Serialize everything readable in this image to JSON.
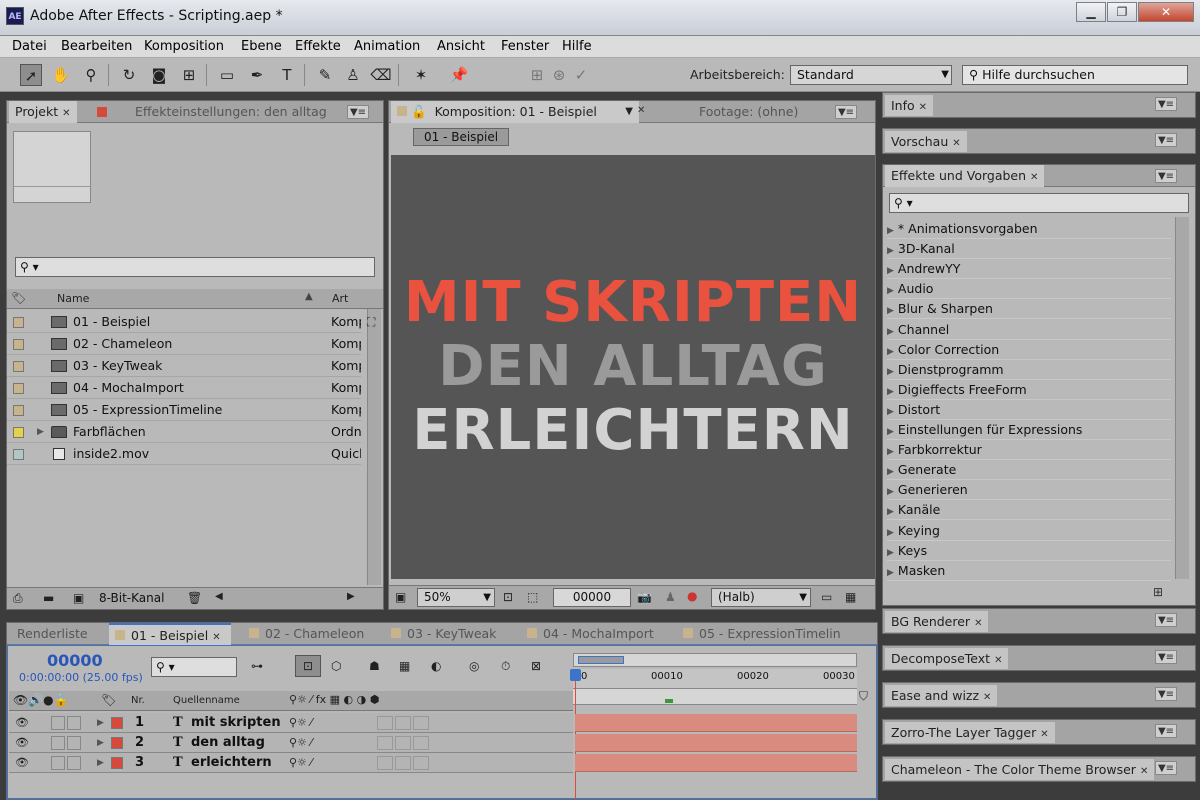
{
  "window": {
    "title": "Adobe After Effects - Scripting.aep *",
    "app_badge": "AE"
  },
  "menu": [
    "Datei",
    "Bearbeiten",
    "Komposition",
    "Ebene",
    "Effekte",
    "Animation",
    "Ansicht",
    "Fenster",
    "Hilfe"
  ],
  "toolbar": {
    "workspace_label": "Arbeitsbereich:",
    "workspace_value": "Standard",
    "help_placeholder": "Hilfe durchsuchen"
  },
  "project": {
    "tab_project": "Projekt",
    "tab_effects": "Effekteinstellungen: den alltag",
    "col_name": "Name",
    "col_type": "Art",
    "items": [
      {
        "name": "01 - Beispiel",
        "type": "Komp",
        "color": "#c8b48c",
        "icon": "composition-icon"
      },
      {
        "name": "02 - Chameleon",
        "type": "Komp",
        "color": "#c8b48c",
        "icon": "composition-icon"
      },
      {
        "name": "03 - KeyTweak",
        "type": "Komp",
        "color": "#c8b48c",
        "icon": "composition-icon"
      },
      {
        "name": "04 - MochaImport",
        "type": "Komp",
        "color": "#c8b48c",
        "icon": "composition-icon"
      },
      {
        "name": "05 - ExpressionTimeline",
        "type": "Komp",
        "color": "#c8b48c",
        "icon": "composition-icon"
      },
      {
        "name": "Farbflächen",
        "type": "Ordne",
        "color": "#e6d24a",
        "icon": "folder-icon"
      },
      {
        "name": "inside2.mov",
        "type": "Quick",
        "color": "#aec8c8",
        "icon": "footage-icon"
      }
    ],
    "bit_depth": "8-Bit-Kanal"
  },
  "composition": {
    "tab_comp": "Komposition: 01 - Beispiel",
    "tab_footage": "Footage: (ohne)",
    "breadcrumb": "01 - Beispiel",
    "line1": "MIT SKRIPTEN",
    "line2": "DEN ALLTAG",
    "line3": "ERLEICHTERN",
    "zoom": "50%",
    "timecode": "00000",
    "resolution": "(Halb)",
    "colors": {
      "line1": "#e8523e",
      "line2": "#9a9a9a",
      "line3": "#d2d2d2",
      "canvas": "#555555"
    }
  },
  "right_panels": {
    "info": "Info",
    "preview": "Vorschau",
    "effects_title": "Effekte und Vorgaben",
    "effects": [
      "* Animationsvorgaben",
      "3D-Kanal",
      "AndrewYY",
      "Audio",
      "Blur & Sharpen",
      "Channel",
      "Color Correction",
      "Dienstprogramm",
      "Digieffects FreeForm",
      "Distort",
      "Einstellungen für Expressions",
      "Farbkorrektur",
      "Generate",
      "Generieren",
      "Kanäle",
      "Keying",
      "Keys",
      "Masken"
    ],
    "scripts": [
      "BG Renderer",
      "DecomposeText",
      "Ease and wizz",
      "Zorro-The Layer Tagger",
      "Chameleon - The Color Theme Browser"
    ]
  },
  "timeline": {
    "tabs": [
      "Renderliste",
      "01 - Beispiel",
      "02 - Chameleon",
      "03 - KeyTweak",
      "04 - MochaImport",
      "05 - ExpressionTimelin"
    ],
    "timecode": "00000",
    "timecode_sub": "0:00:00:00 (25.00 fps)",
    "col_nr": "Nr.",
    "col_source": "Quellenname",
    "ruler": [
      "00010",
      "00020",
      "00030"
    ],
    "ruler_start": "0",
    "layers": [
      {
        "nr": "1",
        "type": "T",
        "name": "mit skripten"
      },
      {
        "nr": "2",
        "type": "T",
        "name": "den alltag"
      },
      {
        "nr": "3",
        "type": "T",
        "name": "erleichtern"
      }
    ]
  }
}
